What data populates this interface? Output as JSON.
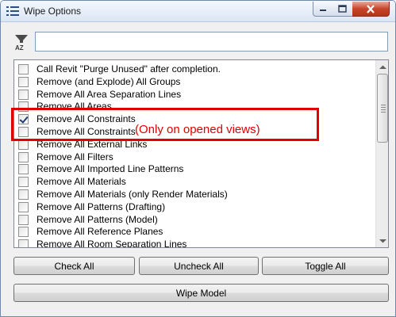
{
  "window": {
    "title": "Wipe Options"
  },
  "search": {
    "value": "",
    "placeholder": ""
  },
  "filter": {
    "icon": "sort-az-filter-icon",
    "letters": "AZ"
  },
  "list": {
    "items": [
      {
        "label": "Call Revit \"Purge Unused\" after completion.",
        "checked": false
      },
      {
        "label": "Remove (and Explode) All Groups",
        "checked": false
      },
      {
        "label": "Remove All Area Separation Lines",
        "checked": false
      },
      {
        "label": "Remove All Areas",
        "checked": false
      },
      {
        "label": "Remove All Constraints",
        "checked": true
      },
      {
        "label": "Remove All Constraints",
        "checked": false
      },
      {
        "label": "Remove All External Links",
        "checked": false
      },
      {
        "label": "Remove All Filters",
        "checked": false
      },
      {
        "label": "Remove All Imported Line Patterns",
        "checked": false
      },
      {
        "label": "Remove All Materials",
        "checked": false
      },
      {
        "label": "Remove All Materials (only Render Materials)",
        "checked": false
      },
      {
        "label": "Remove All Patterns (Drafting)",
        "checked": false
      },
      {
        "label": "Remove All Patterns (Model)",
        "checked": false
      },
      {
        "label": "Remove All Reference Planes",
        "checked": false
      },
      {
        "label": "Remove All Room Separation Lines",
        "checked": false
      }
    ]
  },
  "annotation": {
    "text": "(Only on opened views)",
    "color": "#e00000"
  },
  "buttons": {
    "check_all": "Check All",
    "uncheck_all": "Uncheck All",
    "toggle_all": "Toggle All",
    "wipe_model": "Wipe Model"
  },
  "colors": {
    "title_bar": "#dbe6f4",
    "close_button": "#c7452c",
    "annotation": "#e00000"
  }
}
